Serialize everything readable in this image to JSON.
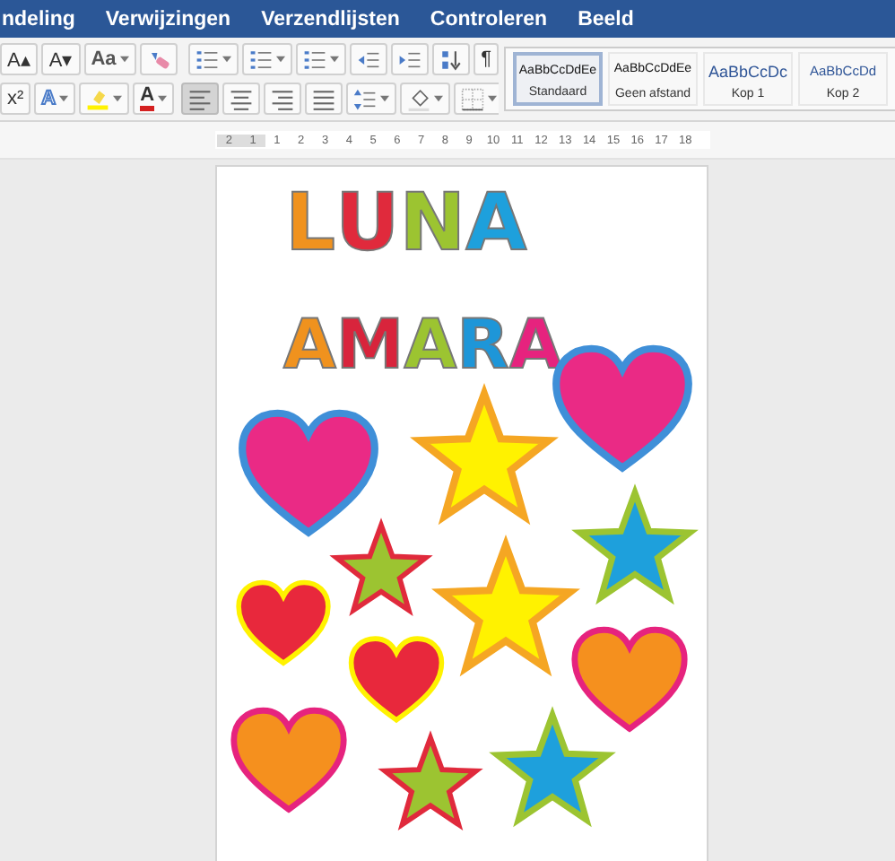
{
  "tabs": [
    {
      "label": "ndeling",
      "selected": false
    },
    {
      "label": "Verwijzingen",
      "selected": false
    },
    {
      "label": "Verzendlijsten",
      "selected": false
    },
    {
      "label": "Controleren",
      "selected": false
    },
    {
      "label": "Beeld",
      "selected": false
    }
  ],
  "toolbar_rows": [
    {
      "items": [
        {
          "kind": "text",
          "label": "A▴"
        },
        {
          "kind": "text",
          "label": "A▾"
        },
        {
          "kind": "case",
          "label": "Aa",
          "dropdown": true
        },
        {
          "kind": "eraser"
        },
        {
          "kind": "gap"
        },
        {
          "kind": "bullets",
          "dropdown": true
        },
        {
          "kind": "numbering",
          "dropdown": true
        },
        {
          "kind": "multilevel",
          "dropdown": true
        },
        {
          "kind": "indent-decrease"
        },
        {
          "kind": "indent-increase"
        },
        {
          "kind": "sort"
        },
        {
          "kind": "text",
          "label": "¶"
        }
      ]
    },
    {
      "items": [
        {
          "kind": "text",
          "label": "x²"
        },
        {
          "kind": "effect",
          "label": "A",
          "dropdown": true
        },
        {
          "kind": "highlight",
          "dropdown": true
        },
        {
          "kind": "font-color",
          "label": "A",
          "dropdown": true
        },
        {
          "kind": "gap"
        },
        {
          "kind": "align-left",
          "selected": true
        },
        {
          "kind": "align-center",
          "selected": false
        },
        {
          "kind": "align-right",
          "selected": false
        },
        {
          "kind": "justify",
          "selected": false
        },
        {
          "kind": "line-spacing",
          "dropdown": true
        },
        {
          "kind": "shading",
          "dropdown": true
        },
        {
          "kind": "borders",
          "dropdown": true
        }
      ]
    }
  ],
  "styles": [
    {
      "preview": "AaBbCcDdEe",
      "name": "Standaard",
      "kind": "normal",
      "selected": true
    },
    {
      "preview": "AaBbCcDdEe",
      "name": "Geen afstand",
      "kind": "normal",
      "selected": false
    },
    {
      "preview": "AaBbCcDc",
      "name": "Kop 1",
      "kind": "heading1",
      "selected": false
    },
    {
      "preview": "AaBbCcDd",
      "name": "Kop 2",
      "kind": "heading2",
      "selected": false
    }
  ],
  "ruler": [
    "2",
    "1",
    "1",
    "2",
    "3",
    "4",
    "5",
    "6",
    "7",
    "8",
    "9",
    "10",
    "11",
    "12",
    "13",
    "14",
    "15",
    "16",
    "17",
    "18"
  ],
  "words": [
    {
      "letters": [
        {
          "char": "L",
          "color": "#f0921e"
        },
        {
          "char": "U",
          "color": "#e02a3c"
        },
        {
          "char": "N",
          "color": "#9cc431"
        },
        {
          "char": "A",
          "color": "#1ea0dc"
        }
      ]
    },
    {
      "letters": [
        {
          "char": "A",
          "color": "#f0921e"
        },
        {
          "char": "M",
          "color": "#d8243c"
        },
        {
          "char": "A",
          "color": "#9cc431"
        },
        {
          "char": "R",
          "color": "#1e96d8"
        },
        {
          "char": "A",
          "color": "#e6237e"
        }
      ]
    }
  ],
  "shapes": [
    {
      "kind": "heart",
      "color": "#ea2a85",
      "border": {
        "color": "#3f8fd8"
      }
    },
    {
      "kind": "star",
      "color": "#fff200",
      "border": {
        "color": "#f5a623"
      }
    },
    {
      "kind": "heart",
      "color": "#ea2a85",
      "border": {
        "color": "#3f8fd8"
      }
    },
    {
      "kind": "star",
      "color": "#9cc431",
      "border": {
        "color": "#e02a3c"
      }
    },
    {
      "kind": "star",
      "color": "#fff200",
      "border": {
        "color": "#f5a623"
      }
    },
    {
      "kind": "star",
      "color": "#1ea0dc",
      "border": {
        "color": "#9cc431"
      }
    },
    {
      "kind": "heart",
      "color": "#e8283c",
      "border": {
        "color": "#fff200"
      }
    },
    {
      "kind": "heart",
      "color": "#e8283c",
      "border": {
        "color": "#fff200"
      }
    },
    {
      "kind": "heart",
      "color": "#f5901e",
      "border": {
        "color": "#e6237e"
      }
    },
    {
      "kind": "heart",
      "color": "#f5901e",
      "border": {
        "color": "#e6237e"
      }
    },
    {
      "kind": "star",
      "color": "#9cc431",
      "border": {
        "color": "#e02a3c"
      }
    },
    {
      "kind": "star",
      "color": "#1ea0dc",
      "border": {
        "color": "#9cc431"
      }
    }
  ]
}
